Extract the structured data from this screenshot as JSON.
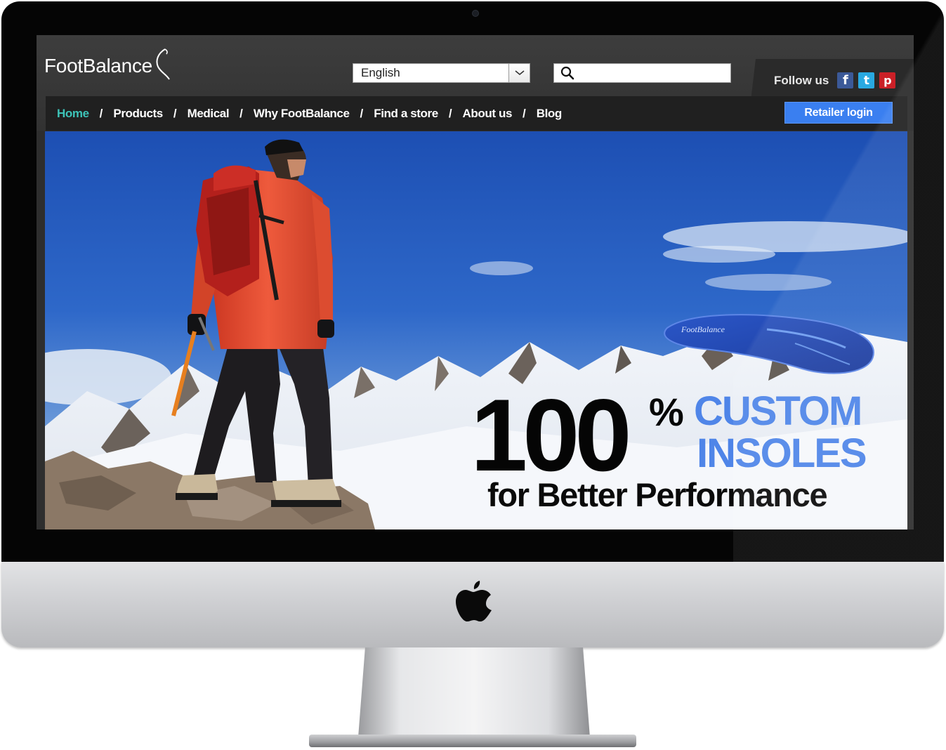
{
  "site": {
    "logo_text": "FootBalance",
    "language": {
      "selected": "English"
    },
    "search": {
      "placeholder": ""
    },
    "social": {
      "follow_label": "Follow us",
      "facebook_glyph": "f",
      "twitter_glyph": "t",
      "pinterest_glyph": "p",
      "icons": [
        "facebook-icon",
        "twitter-icon",
        "pinterest-icon"
      ]
    },
    "nav": {
      "items": [
        {
          "label": "Home",
          "active": true
        },
        {
          "label": "Products",
          "active": false
        },
        {
          "label": "Medical",
          "active": false
        },
        {
          "label": "Why FootBalance",
          "active": false
        },
        {
          "label": "Find a store",
          "active": false
        },
        {
          "label": "About us",
          "active": false
        },
        {
          "label": "Blog",
          "active": false
        }
      ],
      "separator": "/",
      "retailer_login": "Retailer login"
    },
    "hero": {
      "number": "100",
      "percent": "%",
      "custom": "CUSTOM",
      "insoles": "INSOLES",
      "subtitle": "for Better Performance",
      "insole_brand": "FootBalance"
    }
  },
  "colors": {
    "accent_blue": "#4f85e8",
    "button_blue": "#3a7ff0",
    "active_nav": "#3dc3b8",
    "header_bg": "#3a3a3a",
    "nav_bg": "#202020"
  }
}
